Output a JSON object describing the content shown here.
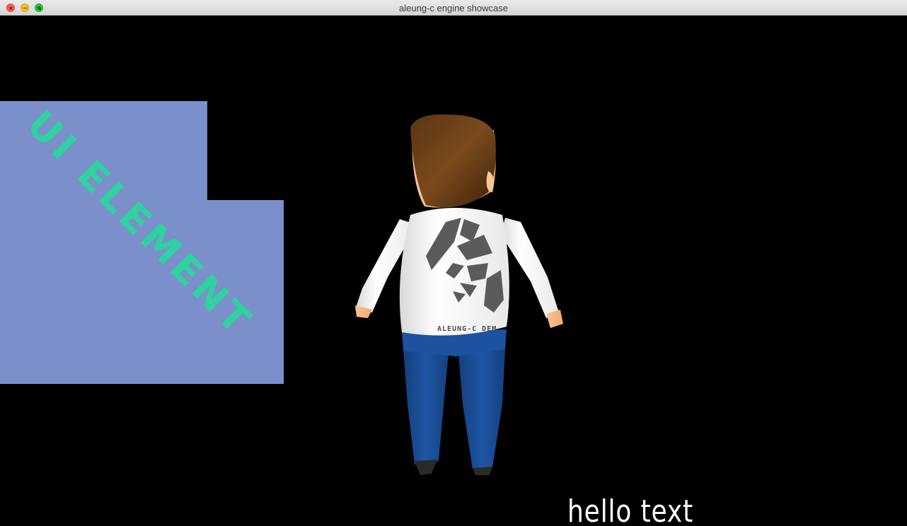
{
  "window": {
    "title": "aleung-c engine showcase"
  },
  "controls": {
    "close": "close-icon",
    "minimize": "minimize-icon",
    "maximize": "fullscreen-icon"
  },
  "ui_element": {
    "label": "UI ELEMENT",
    "panel_color": "#7b8fcb",
    "text_color": "#2ed3a0"
  },
  "character": {
    "shirt_text": "ALEUNG-C DEM"
  },
  "hello_text": "hello  text"
}
